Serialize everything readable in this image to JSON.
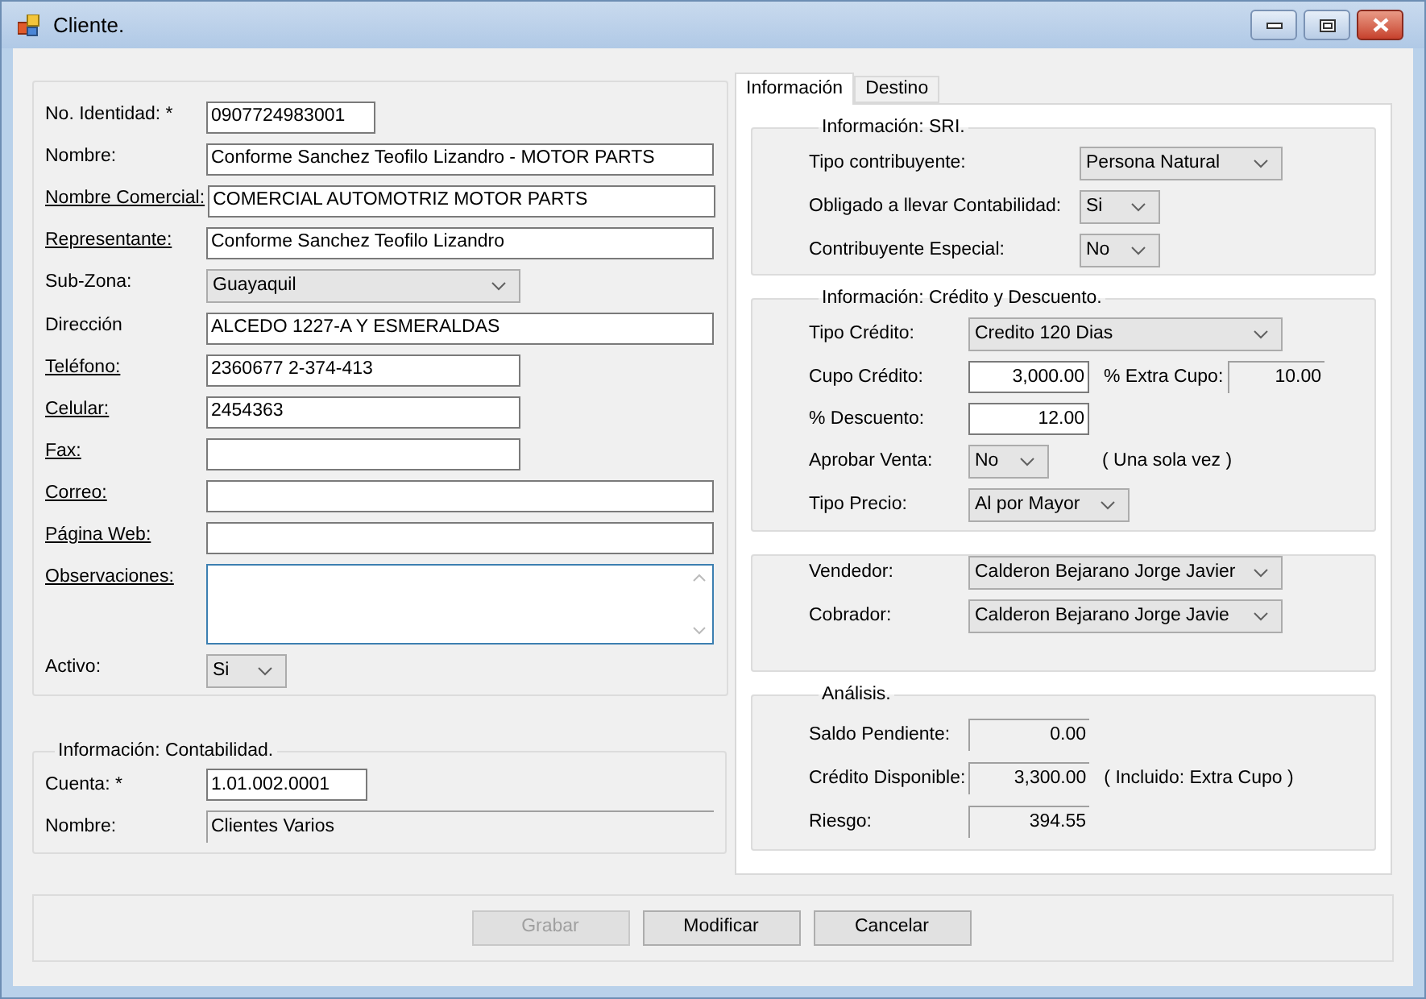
{
  "window": {
    "title": "Cliente."
  },
  "cliente": {
    "fields": [
      {
        "kind": "text",
        "label": "No. Identidad: *",
        "value": "0907724983001",
        "link": false
      },
      {
        "kind": "text",
        "label": "Nombre:",
        "value": "Conforme Sanchez Teofilo Lizandro - MOTOR PARTS",
        "link": false
      },
      {
        "kind": "text",
        "label": "Nombre Comercial:",
        "value": "COMERCIAL AUTOMOTRIZ MOTOR PARTS",
        "link": true
      },
      {
        "kind": "text",
        "label": "Representante:",
        "value": "Conforme Sanchez Teofilo Lizandro",
        "link": true
      },
      {
        "kind": "select",
        "label": "Sub-Zona:",
        "value": "Guayaquil",
        "link": false
      },
      {
        "kind": "text",
        "label": "Dirección",
        "value": "ALCEDO 1227-A Y ESMERALDAS",
        "link": false
      },
      {
        "kind": "text",
        "label": "Teléfono:",
        "value": "2360677  2-374-413",
        "link": true
      },
      {
        "kind": "text",
        "label": "Celular:",
        "value": "2454363",
        "link": true
      },
      {
        "kind": "text",
        "label": "Fax:",
        "link": true
      },
      {
        "kind": "text",
        "label": "Correo:",
        "link": true
      },
      {
        "kind": "text",
        "label": "Página Web:",
        "link": true
      },
      {
        "kind": "textarea",
        "label": "Observaciones:",
        "link": true
      },
      {
        "kind": "select",
        "label": "Activo:",
        "value": "Si",
        "link": false
      }
    ]
  },
  "contabilidad": {
    "title": "Información: Contabilidad.",
    "fields": [
      {
        "label": "Cuenta: *",
        "value": "1.01.002.0001",
        "readonly": false
      },
      {
        "label": "Nombre:",
        "value": "Clientes Varios",
        "readonly": true
      }
    ]
  },
  "tabs": [
    {
      "label": "Información",
      "selected": true
    },
    {
      "label": "Destino",
      "selected": false
    }
  ],
  "sri": {
    "title": "Información: SRI.",
    "fields": [
      {
        "label": "Tipo contribuyente:",
        "value": "Persona Natural"
      },
      {
        "label": "Obligado a llevar Contabilidad:",
        "value": "Si"
      },
      {
        "label": "Contribuyente Especial:",
        "value": "No"
      }
    ]
  },
  "credito": {
    "title": "Información: Crédito y Descuento.",
    "fields": [
      {
        "kind": "select",
        "label": "Tipo Crédito:",
        "value": "Credito 120 Dias"
      },
      {
        "kind": "number",
        "label": "Cupo Crédito:",
        "value": "3,000.00",
        "extra_label": "% Extra Cupo:",
        "extra_value": "10.00"
      },
      {
        "kind": "number",
        "label": "% Descuento:",
        "value": "12.00"
      },
      {
        "kind": "select",
        "label": "Aprobar Venta:",
        "value": "No",
        "note": "( Una sola vez )"
      },
      {
        "kind": "select",
        "label": "Tipo Precio:",
        "value": "Al por Mayor"
      }
    ]
  },
  "personal": {
    "fields": [
      {
        "label": "Vendedor:",
        "value": "Calderon Bejarano Jorge Javier"
      },
      {
        "label": "Cobrador:",
        "value": "Calderon Bejarano Jorge Javie"
      }
    ]
  },
  "analisis": {
    "title": "Análisis.",
    "fields": [
      {
        "label": "Saldo Pendiente:",
        "value": "0.00"
      },
      {
        "label": "Crédito Disponible:",
        "value": "3,300.00",
        "note": "( Incluido: Extra Cupo )"
      },
      {
        "label": "Riesgo:",
        "value": "394.55"
      }
    ]
  },
  "buttons": [
    {
      "label": "Grabar",
      "disabled": true
    },
    {
      "label": "Modificar",
      "disabled": false
    },
    {
      "label": "Cancelar",
      "disabled": false
    }
  ]
}
